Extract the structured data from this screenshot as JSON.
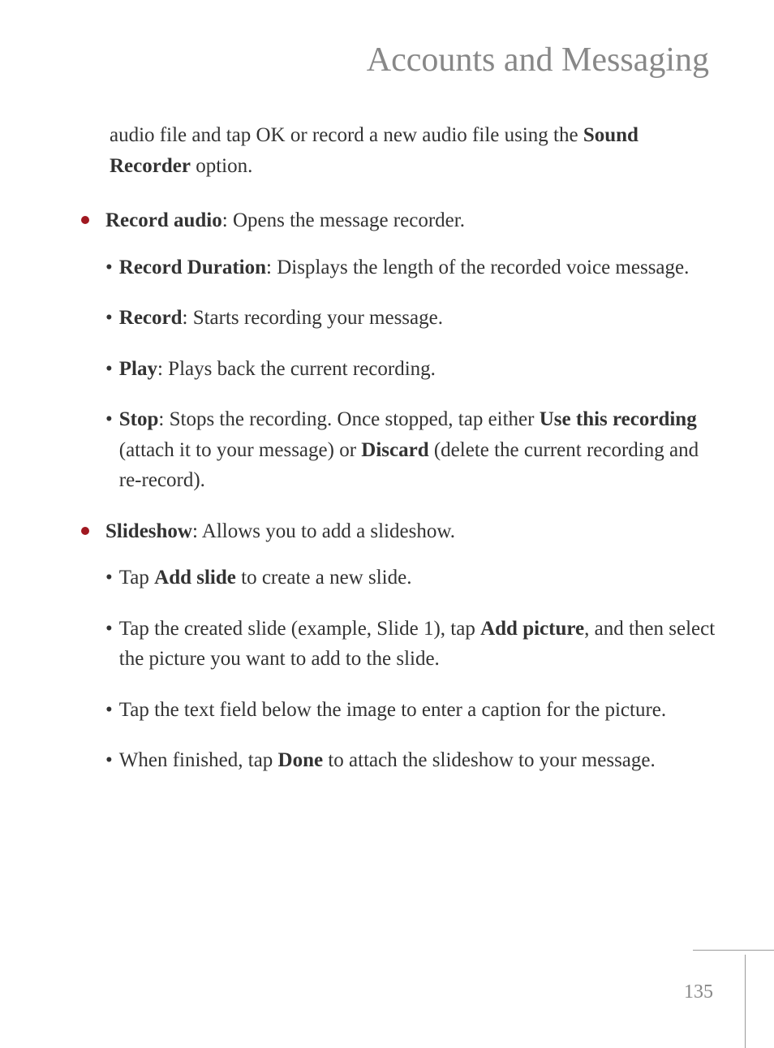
{
  "title": "Accounts and Messaging",
  "intro": {
    "text1": "audio file and tap OK or record a new audio file using the ",
    "bold1": "Sound Recorder",
    "text2": " option."
  },
  "items": [
    {
      "label": "Record audio",
      "desc": ": Opens the message recorder.",
      "subitems": [
        {
          "label": "Record Duration",
          "desc": ": Displays the length of the recorded voice message."
        },
        {
          "label": "Record",
          "desc": ": Starts recording your message."
        },
        {
          "label": "Play",
          "desc": ": Plays back the current recording."
        },
        {
          "label": "Stop",
          "desc_parts": [
            {
              "text": ": Stops the recording. Once stopped, tap either "
            },
            {
              "bold": "Use this recording"
            },
            {
              "text": " (attach it to your message) or "
            },
            {
              "bold": "Discard"
            },
            {
              "text": " (delete the current recording and re-record)."
            }
          ]
        }
      ]
    },
    {
      "label": "Slideshow",
      "desc": ": Allows you to add a slideshow.",
      "subitems": [
        {
          "desc_parts": [
            {
              "text": "Tap "
            },
            {
              "bold": "Add slide"
            },
            {
              "text": " to create a new slide."
            }
          ]
        },
        {
          "desc_parts": [
            {
              "text": "Tap the created slide (example, Slide 1), tap "
            },
            {
              "bold": "Add picture"
            },
            {
              "text": ", and then select the picture you want to add to the slide."
            }
          ]
        },
        {
          "desc_parts": [
            {
              "text": "Tap the text field below the image to enter a caption for the picture."
            }
          ]
        },
        {
          "desc_parts": [
            {
              "text": "When finished, tap "
            },
            {
              "bold": "Done"
            },
            {
              "text": " to attach the slideshow to your message."
            }
          ]
        }
      ]
    }
  ],
  "pageNumber": "135"
}
